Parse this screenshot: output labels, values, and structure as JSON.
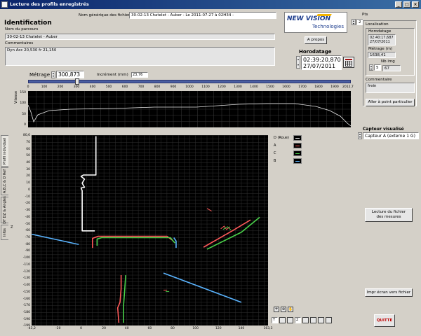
{
  "window": {
    "title": "Lecture des profils enregistrés",
    "buttons": [
      "_",
      "□",
      "×"
    ]
  },
  "header": {
    "section_title": "Identification",
    "generic_name_label": "Nom générique des fichiers",
    "generic_name_value": "30-02-13 Chatelet - Auber - Le 2011-07-27 à 02H34 -"
  },
  "route": {
    "label": "Nom du parcours",
    "value": "30-02-13 Chatelet - Auber"
  },
  "comments": {
    "label": "Commentaires",
    "value": "Dyn Acc 20,530 fr 21,150"
  },
  "logo": {
    "line1": "NEW VISION",
    "line2": "Technologies"
  },
  "about_button": "A propos",
  "timestamp": {
    "label": "Horodatage",
    "time": "02:39:20,870",
    "date": "27/07/2011"
  },
  "pts": {
    "label": "Pts",
    "value": "2"
  },
  "localisation": {
    "label": "Localisation",
    "horodatage_label": "Horodatage",
    "horodatage_time": "02:40:17,687",
    "horodatage_date": "27/07/2011",
    "metrage_label": "Métrage (m)",
    "metrage_value": "1638,41",
    "nb_img_label": "Nb img",
    "nb_img_left": "5",
    "nb_img_right": "67",
    "commentaire_label": "Commentaire",
    "commentaire_value": "frein",
    "goto_button": "Aller à point particulier"
  },
  "metrage": {
    "label": "Métrage",
    "value": "300,873",
    "increment_label": "Incrément (mm)",
    "increment_value": "23,76",
    "fraction": 0.149,
    "scale_ticks": [
      "0",
      "100",
      "200",
      "300",
      "400",
      "500",
      "600",
      "700",
      "800",
      "900",
      "1000",
      "1100",
      "1200",
      "1300",
      "1400",
      "1500",
      "1600",
      "1700",
      "1800",
      "1900",
      "2012,7"
    ]
  },
  "speed_chart": {
    "ylabel": "Vitesse",
    "y_ticks": [
      "150",
      "100",
      "50",
      "0"
    ]
  },
  "tabs": [
    {
      "label": "Profil individuel",
      "active": true
    },
    {
      "label": "A,B,C & D Ref",
      "active": false
    },
    {
      "label": "DY DZ & Angles",
      "active": false
    },
    {
      "label": "Infos",
      "active": false
    }
  ],
  "profile_chart": {
    "zlabel": "Z",
    "y_ticks": [
      "80,6",
      "70",
      "60",
      "50",
      "40",
      "30",
      "20",
      "10",
      "0",
      "-10",
      "-20",
      "-30",
      "-40",
      "-50",
      "-60",
      "-70",
      "-80",
      "-90",
      "-100",
      "-110",
      "-120",
      "-130",
      "-140",
      "-150",
      "-160",
      "-170",
      "-180",
      "-190",
      "-199"
    ],
    "x_ticks": [
      "-43,2",
      "-20",
      "0",
      "20",
      "40",
      "60",
      "80",
      "100",
      "120",
      "140",
      "163,3"
    ],
    "legend": [
      "D (Roue)",
      "A",
      "C",
      "B"
    ],
    "colors": {
      "D": "#ffffff",
      "A": "#ff5a5a",
      "C": "#4ad14a",
      "B": "#5ab4ff"
    }
  },
  "toolbar": {
    "field1": "Y",
    "field2": "2"
  },
  "sensor": {
    "label": "Capteur visualisé",
    "value": "Capteur A (externe 1 G)"
  },
  "actions": {
    "read_button": "Lecture du fichier\ndes mesures",
    "print_button": "Impr écran vers fichier",
    "quit_button": "QUITTE"
  }
}
